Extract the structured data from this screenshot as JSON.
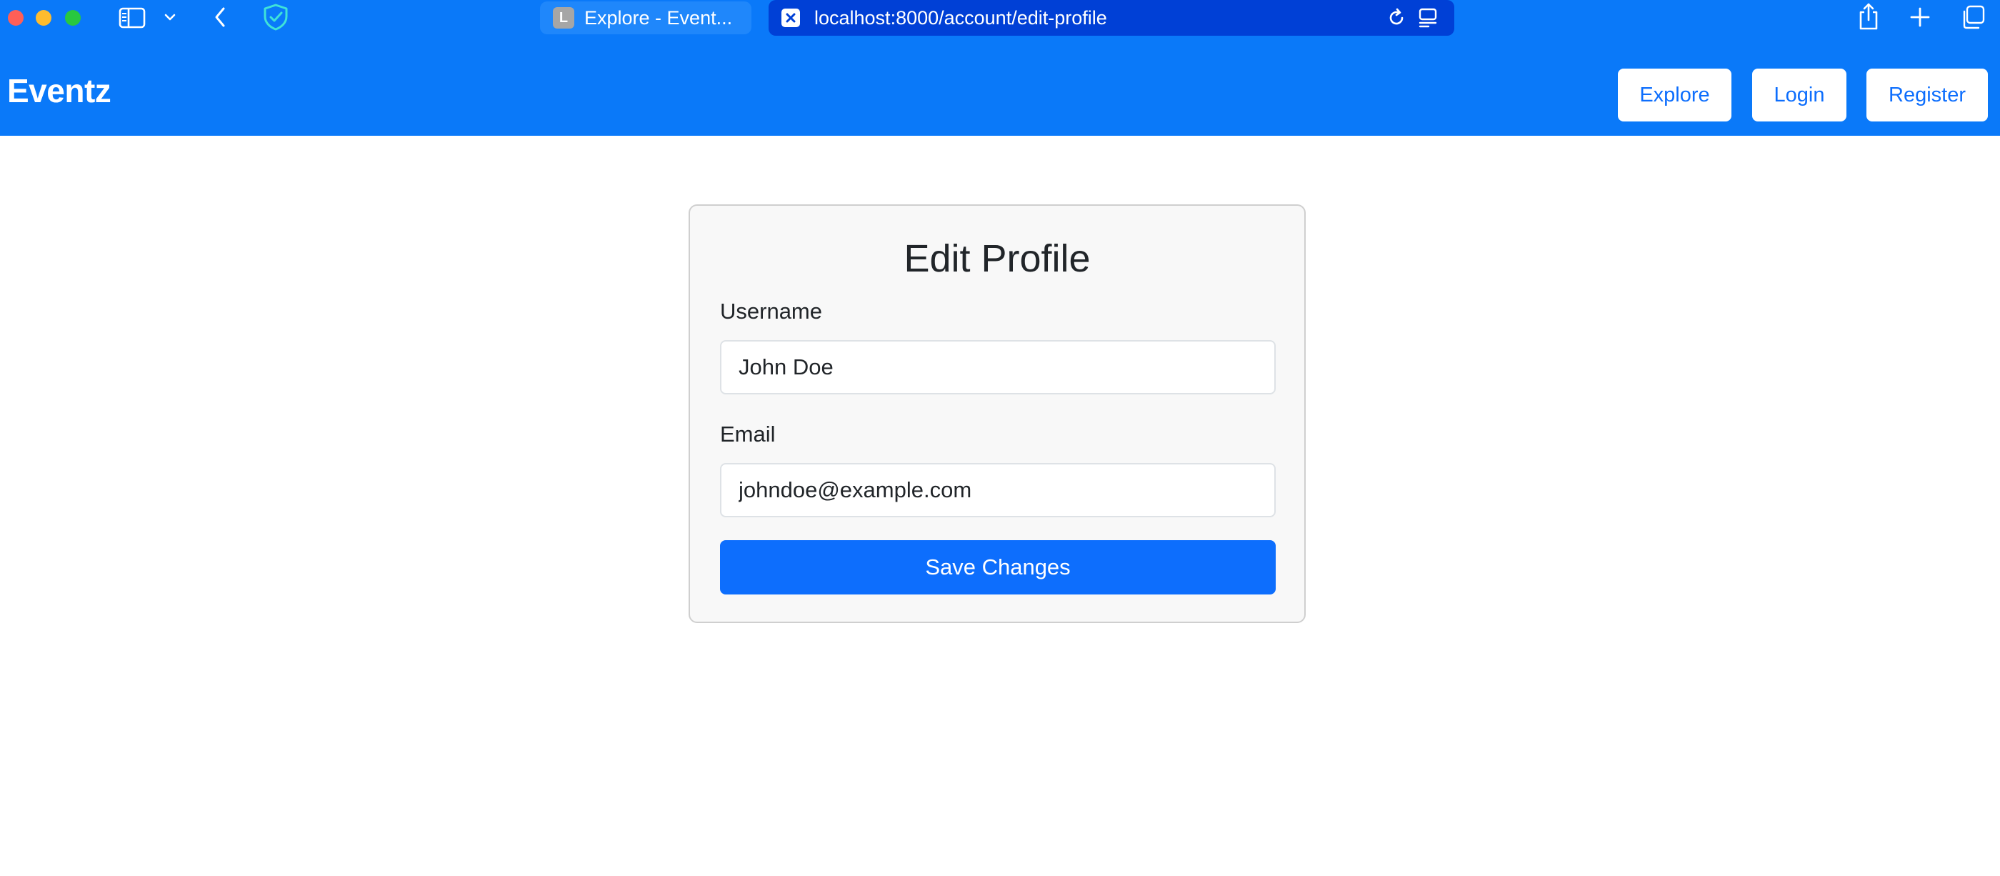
{
  "browser": {
    "tabs": [
      {
        "favicon_letter": "L",
        "title": "Explore - Event..."
      }
    ],
    "address_bar": {
      "url": "localhost:8000/account/edit-profile"
    },
    "icons": {
      "sidebar": "sidebar-icon",
      "chevron": "chevron-down-icon",
      "back": "back-arrow-icon",
      "shield": "shield-check-icon",
      "reload": "reload-icon",
      "reader": "reader-icon",
      "share": "share-icon",
      "new_tab": "plus-icon",
      "tab_overview": "tabs-overview-icon"
    }
  },
  "navbar": {
    "brand": "Eventz",
    "links": {
      "explore": "Explore",
      "login": "Login",
      "register": "Register"
    }
  },
  "form": {
    "title": "Edit Profile",
    "username": {
      "label": "Username",
      "value": "John Doe"
    },
    "email": {
      "label": "Email",
      "value": "johndoe@example.com"
    },
    "submit_label": "Save Changes"
  },
  "colors": {
    "navbar_bg": "#0a79f9",
    "primary": "#0d6efd",
    "active_tab_bg": "#0040d6",
    "card_bg": "#f8f8f8"
  }
}
